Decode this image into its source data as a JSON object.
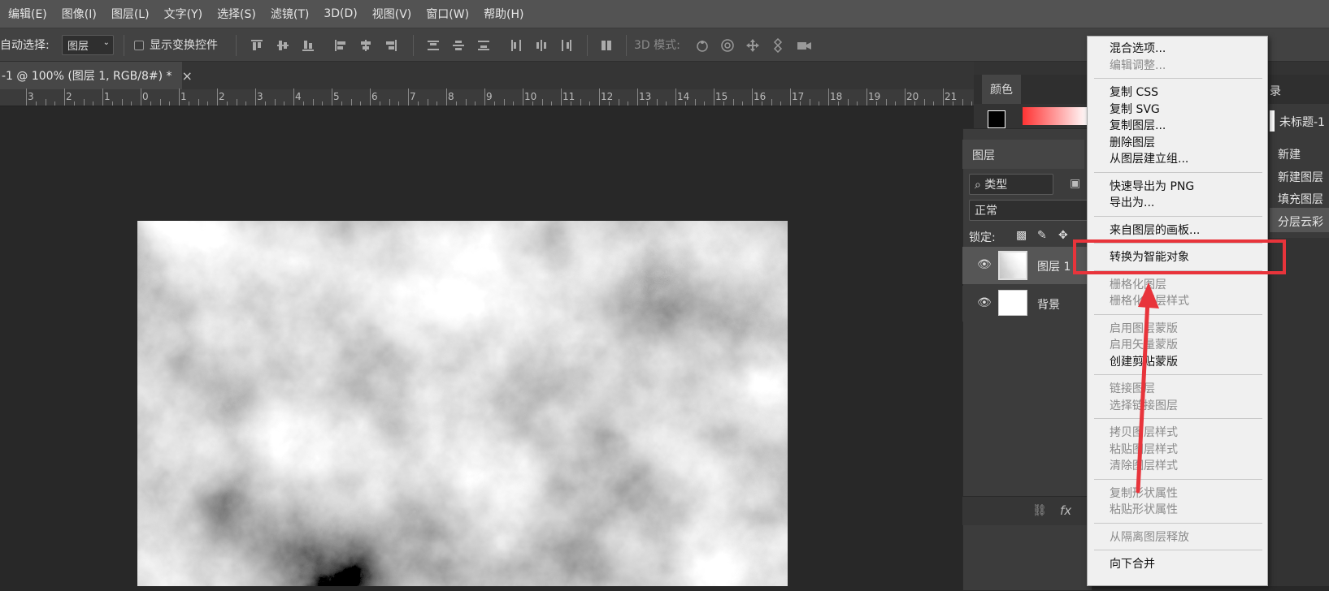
{
  "menubar": {
    "items": [
      "编辑(E)",
      "图像(I)",
      "图层(L)",
      "文字(Y)",
      "选择(S)",
      "滤镜(T)",
      "3D(D)",
      "视图(V)",
      "窗口(W)",
      "帮助(H)"
    ]
  },
  "options": {
    "auto_select_label": "自动选择:",
    "auto_select_value": "图层",
    "show_transform_label": "显示变换控件",
    "mode3d_label": "3D 模式:"
  },
  "document": {
    "tab_title": "-1 @ 100% (图层 1, RGB/8#) *",
    "close_glyph": "×"
  },
  "ruler": {
    "labels": [
      "3",
      "2",
      "1",
      "0",
      "1",
      "2",
      "3",
      "4",
      "5",
      "6",
      "7",
      "8",
      "9",
      "10",
      "11",
      "12",
      "13",
      "14",
      "15",
      "16",
      "17",
      "18",
      "19",
      "20",
      "21"
    ]
  },
  "color_panel": {
    "tab_label": "颜色"
  },
  "layers_panel": {
    "tab_label": "图层",
    "filter_label": "类型",
    "blend_mode": "正常",
    "lock_label": "锁定:",
    "layers": [
      {
        "name": "图层 1"
      },
      {
        "name": "背景"
      }
    ],
    "fx_label": "fx"
  },
  "history_panel": {
    "tab_label": "录",
    "doc_label": "未标题-1",
    "items": [
      "新建",
      "新建图层",
      "填充图层",
      "分层云彩"
    ]
  },
  "context_menu": {
    "groups": [
      [
        {
          "label": "混合选项...",
          "disabled": false
        },
        {
          "label": "编辑调整...",
          "disabled": true
        }
      ],
      [
        {
          "label": "复制 CSS",
          "disabled": false
        },
        {
          "label": "复制 SVG",
          "disabled": false
        },
        {
          "label": "复制图层...",
          "disabled": false
        },
        {
          "label": "删除图层",
          "disabled": false
        },
        {
          "label": "从图层建立组...",
          "disabled": false
        }
      ],
      [
        {
          "label": "快速导出为 PNG",
          "disabled": false
        },
        {
          "label": "导出为...",
          "disabled": false
        }
      ],
      [
        {
          "label": "来自图层的画板...",
          "disabled": false
        }
      ],
      [
        {
          "label": "转换为智能对象",
          "disabled": false
        }
      ],
      [
        {
          "label": "栅格化图层",
          "disabled": true
        },
        {
          "label": "栅格化图层样式",
          "disabled": true
        }
      ],
      [
        {
          "label": "启用图层蒙版",
          "disabled": true
        },
        {
          "label": "启用矢量蒙版",
          "disabled": true
        },
        {
          "label": "创建剪贴蒙版",
          "disabled": false
        }
      ],
      [
        {
          "label": "链接图层",
          "disabled": true
        },
        {
          "label": "选择链接图层",
          "disabled": true
        }
      ],
      [
        {
          "label": "拷贝图层样式",
          "disabled": true
        },
        {
          "label": "粘贴图层样式",
          "disabled": true
        },
        {
          "label": "清除图层样式",
          "disabled": true
        }
      ],
      [
        {
          "label": "复制形状属性",
          "disabled": true
        },
        {
          "label": "粘贴形状属性",
          "disabled": true
        }
      ],
      [
        {
          "label": "从隔离图层释放",
          "disabled": true
        }
      ],
      [
        {
          "label": "向下合并",
          "disabled": false
        }
      ]
    ]
  },
  "annotation": {
    "highlight_color": "#e8343b",
    "arrow_color": "#e8343b"
  }
}
